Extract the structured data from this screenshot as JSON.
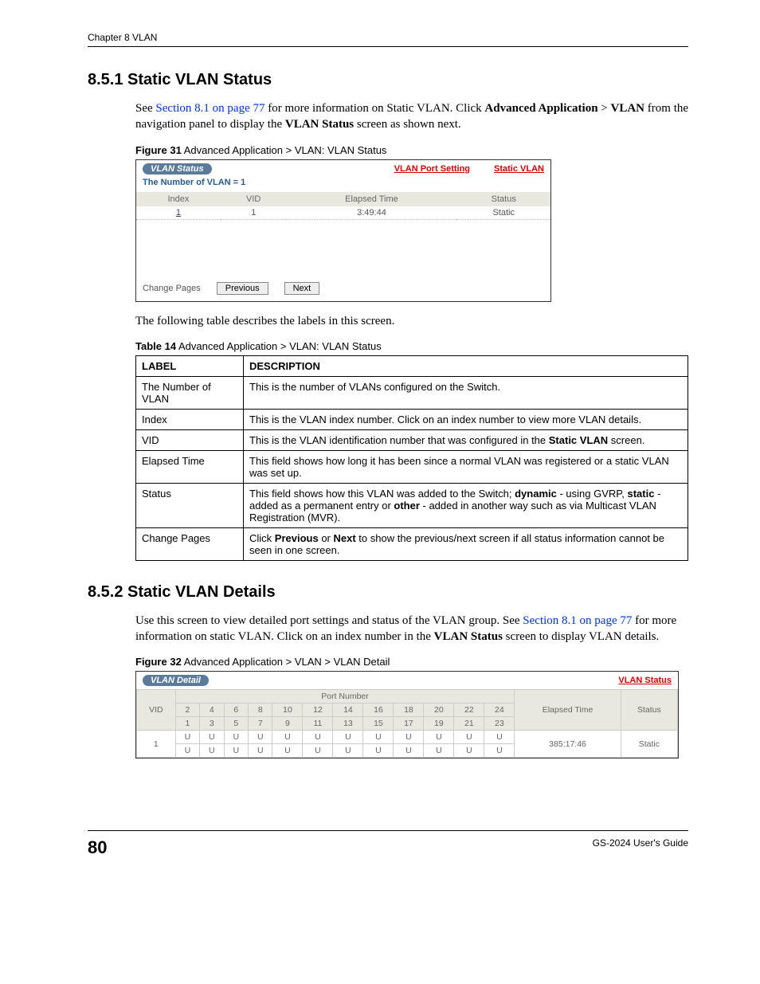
{
  "header": {
    "chapter": "Chapter 8 VLAN"
  },
  "s851": {
    "heading": "8.5.1  Static VLAN Status",
    "para_lead": "See ",
    "para_link": "Section 8.1 on page 77",
    "para_mid": " for more information on Static VLAN. Click ",
    "adv_app": "Advanced Application",
    "gt": " > ",
    "vlan": "VLAN",
    "para_tail": " from the navigation panel to display the ",
    "vlan_status": "VLAN Status",
    "para_end": " screen as shown next."
  },
  "fig31": {
    "caption_lead": "Figure 31",
    "caption_rest": "   Advanced Application > VLAN: VLAN Status",
    "tab": "VLAN Status",
    "link_port": "VLAN Port Setting",
    "link_static": "Static VLAN",
    "number_of_vlan": "The Number of VLAN = 1",
    "cols": {
      "index": "Index",
      "vid": "VID",
      "elapsed": "Elapsed Time",
      "status": "Status"
    },
    "row": {
      "index": "1",
      "vid": "1",
      "elapsed": "3:49:44",
      "status": "Static"
    },
    "change_pages": "Change Pages",
    "prev": "Previous",
    "next": "Next"
  },
  "para2": "The following table describes the labels in this screen.",
  "tbl14": {
    "caption_lead": "Table 14",
    "caption_rest": "   Advanced Application > VLAN: VLAN Status",
    "label_hdr": "LABEL",
    "desc_hdr": "DESCRIPTION",
    "r0": {
      "label": "The Number of VLAN",
      "desc": "This is the number of VLANs configured on the Switch."
    },
    "r1": {
      "label": "Index",
      "desc": "This is the VLAN index number. Click on an index number to view more VLAN details."
    },
    "r2": {
      "label": "VID",
      "desc_lead": "This is the VLAN identification number that was configured in the ",
      "desc_bold": "Static VLAN",
      "desc_tail": " screen."
    },
    "r3": {
      "label": "Elapsed Time",
      "desc": "This field shows how long it has been since a normal VLAN was registered or a static VLAN was set up."
    },
    "r4": {
      "label": "Status",
      "lead": "This field shows how this VLAN was added to the Switch; ",
      "b1": "dynamic",
      "m1": " - using GVRP, ",
      "b2": "static",
      "m2": " - added as a permanent entry or ",
      "b3": "other",
      "tail": " - added in another way such as via Multicast VLAN Registration (MVR)."
    },
    "r5": {
      "label": "Change Pages",
      "lead": "Click ",
      "b1": "Previous",
      "m1": " or ",
      "b2": "Next",
      "tail": " to show the previous/next screen if all status information cannot be seen in one screen."
    }
  },
  "s852": {
    "heading": "8.5.2  Static VLAN Details",
    "p_lead": "Use this screen to view detailed port settings and status of the VLAN group. See ",
    "p_link": "Section 8.1 on page 77",
    "p_mid": " for more information on static VLAN. Click on an index number in the ",
    "p_bold": "VLAN Status",
    "p_tail": " screen to display VLAN details."
  },
  "fig32": {
    "caption_lead": "Figure 32",
    "caption_rest": "   Advanced Application > VLAN > VLAN Detail",
    "tab": "VLAN Detail",
    "link_status": "VLAN Status",
    "portnum_hdr": "Port Number",
    "vid_hdr": "VID",
    "elapsed_hdr": "Elapsed Time",
    "status_hdr": "Status",
    "ports_even": [
      "2",
      "4",
      "6",
      "8",
      "10",
      "12",
      "14",
      "16",
      "18",
      "20",
      "22",
      "24"
    ],
    "ports_odd": [
      "1",
      "3",
      "5",
      "7",
      "9",
      "11",
      "13",
      "15",
      "17",
      "19",
      "21",
      "23"
    ],
    "vid_val": "1",
    "cell": "U",
    "elapsed_val": "385:17:46",
    "status_val": "Static"
  },
  "footer": {
    "page": "80",
    "guide": "GS-2024 User's Guide"
  }
}
